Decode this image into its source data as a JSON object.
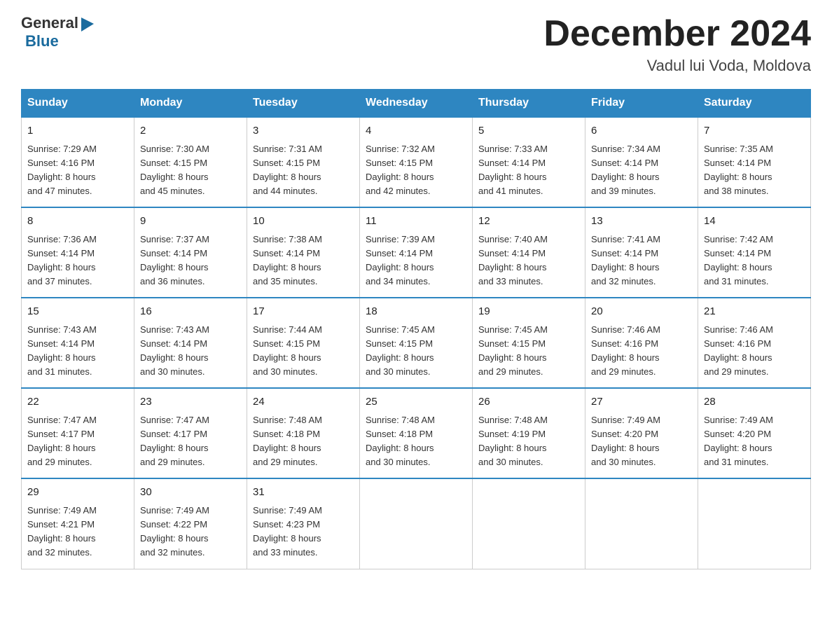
{
  "header": {
    "logo_general": "General",
    "logo_blue": "Blue",
    "month_title": "December 2024",
    "location": "Vadul lui Voda, Moldova"
  },
  "days_of_week": [
    "Sunday",
    "Monday",
    "Tuesday",
    "Wednesday",
    "Thursday",
    "Friday",
    "Saturday"
  ],
  "weeks": [
    [
      {
        "day": "1",
        "sunrise": "7:29 AM",
        "sunset": "4:16 PM",
        "daylight": "8 hours and 47 minutes."
      },
      {
        "day": "2",
        "sunrise": "7:30 AM",
        "sunset": "4:15 PM",
        "daylight": "8 hours and 45 minutes."
      },
      {
        "day": "3",
        "sunrise": "7:31 AM",
        "sunset": "4:15 PM",
        "daylight": "8 hours and 44 minutes."
      },
      {
        "day": "4",
        "sunrise": "7:32 AM",
        "sunset": "4:15 PM",
        "daylight": "8 hours and 42 minutes."
      },
      {
        "day": "5",
        "sunrise": "7:33 AM",
        "sunset": "4:14 PM",
        "daylight": "8 hours and 41 minutes."
      },
      {
        "day": "6",
        "sunrise": "7:34 AM",
        "sunset": "4:14 PM",
        "daylight": "8 hours and 39 minutes."
      },
      {
        "day": "7",
        "sunrise": "7:35 AM",
        "sunset": "4:14 PM",
        "daylight": "8 hours and 38 minutes."
      }
    ],
    [
      {
        "day": "8",
        "sunrise": "7:36 AM",
        "sunset": "4:14 PM",
        "daylight": "8 hours and 37 minutes."
      },
      {
        "day": "9",
        "sunrise": "7:37 AM",
        "sunset": "4:14 PM",
        "daylight": "8 hours and 36 minutes."
      },
      {
        "day": "10",
        "sunrise": "7:38 AM",
        "sunset": "4:14 PM",
        "daylight": "8 hours and 35 minutes."
      },
      {
        "day": "11",
        "sunrise": "7:39 AM",
        "sunset": "4:14 PM",
        "daylight": "8 hours and 34 minutes."
      },
      {
        "day": "12",
        "sunrise": "7:40 AM",
        "sunset": "4:14 PM",
        "daylight": "8 hours and 33 minutes."
      },
      {
        "day": "13",
        "sunrise": "7:41 AM",
        "sunset": "4:14 PM",
        "daylight": "8 hours and 32 minutes."
      },
      {
        "day": "14",
        "sunrise": "7:42 AM",
        "sunset": "4:14 PM",
        "daylight": "8 hours and 31 minutes."
      }
    ],
    [
      {
        "day": "15",
        "sunrise": "7:43 AM",
        "sunset": "4:14 PM",
        "daylight": "8 hours and 31 minutes."
      },
      {
        "day": "16",
        "sunrise": "7:43 AM",
        "sunset": "4:14 PM",
        "daylight": "8 hours and 30 minutes."
      },
      {
        "day": "17",
        "sunrise": "7:44 AM",
        "sunset": "4:15 PM",
        "daylight": "8 hours and 30 minutes."
      },
      {
        "day": "18",
        "sunrise": "7:45 AM",
        "sunset": "4:15 PM",
        "daylight": "8 hours and 30 minutes."
      },
      {
        "day": "19",
        "sunrise": "7:45 AM",
        "sunset": "4:15 PM",
        "daylight": "8 hours and 29 minutes."
      },
      {
        "day": "20",
        "sunrise": "7:46 AM",
        "sunset": "4:16 PM",
        "daylight": "8 hours and 29 minutes."
      },
      {
        "day": "21",
        "sunrise": "7:46 AM",
        "sunset": "4:16 PM",
        "daylight": "8 hours and 29 minutes."
      }
    ],
    [
      {
        "day": "22",
        "sunrise": "7:47 AM",
        "sunset": "4:17 PM",
        "daylight": "8 hours and 29 minutes."
      },
      {
        "day": "23",
        "sunrise": "7:47 AM",
        "sunset": "4:17 PM",
        "daylight": "8 hours and 29 minutes."
      },
      {
        "day": "24",
        "sunrise": "7:48 AM",
        "sunset": "4:18 PM",
        "daylight": "8 hours and 29 minutes."
      },
      {
        "day": "25",
        "sunrise": "7:48 AM",
        "sunset": "4:18 PM",
        "daylight": "8 hours and 30 minutes."
      },
      {
        "day": "26",
        "sunrise": "7:48 AM",
        "sunset": "4:19 PM",
        "daylight": "8 hours and 30 minutes."
      },
      {
        "day": "27",
        "sunrise": "7:49 AM",
        "sunset": "4:20 PM",
        "daylight": "8 hours and 30 minutes."
      },
      {
        "day": "28",
        "sunrise": "7:49 AM",
        "sunset": "4:20 PM",
        "daylight": "8 hours and 31 minutes."
      }
    ],
    [
      {
        "day": "29",
        "sunrise": "7:49 AM",
        "sunset": "4:21 PM",
        "daylight": "8 hours and 32 minutes."
      },
      {
        "day": "30",
        "sunrise": "7:49 AM",
        "sunset": "4:22 PM",
        "daylight": "8 hours and 32 minutes."
      },
      {
        "day": "31",
        "sunrise": "7:49 AM",
        "sunset": "4:23 PM",
        "daylight": "8 hours and 33 minutes."
      },
      null,
      null,
      null,
      null
    ]
  ],
  "labels": {
    "sunrise": "Sunrise: ",
    "sunset": "Sunset: ",
    "daylight": "Daylight: "
  }
}
